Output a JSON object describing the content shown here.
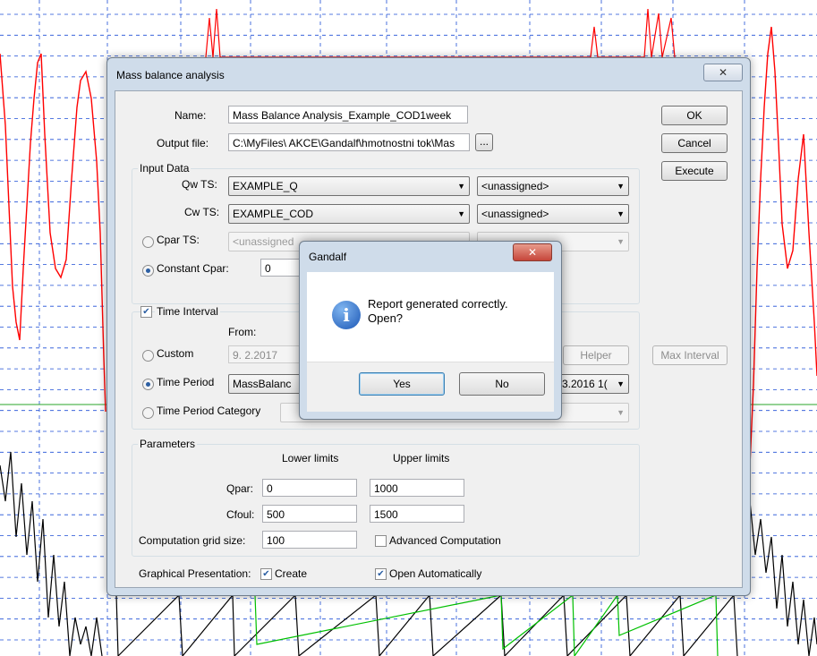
{
  "main_dialog": {
    "title": "Mass balance analysis",
    "close_glyph": "✕",
    "name_label": "Name:",
    "name_value": "Mass Balance Analysis_Example_COD1week",
    "output_label": "Output file:",
    "output_value": "C:\\MyFiles\\ AKCE\\Gandalf\\hmotnostni tok\\Mas",
    "browse_label": "...",
    "buttons": {
      "ok": "OK",
      "cancel": "Cancel",
      "execute": "Execute"
    },
    "input_data": {
      "group_title": "Input Data",
      "qw_label": "Qw TS:",
      "qw_value": "EXAMPLE_Q",
      "qw_secondary": "<unassigned>",
      "cw_label": "Cw TS:",
      "cw_value": "EXAMPLE_COD",
      "cw_secondary": "<unassigned>",
      "cpar_label": "Cpar TS:",
      "cpar_value": "<unassigned",
      "constant_label": "Constant Cpar:",
      "constant_value": "0"
    },
    "time_interval": {
      "checkbox_label": "Time Interval",
      "from_label": "From:",
      "custom_label": "Custom",
      "custom_from": "9.  2.2017",
      "helper_label": "Helper",
      "max_interval_label": "Max Interval",
      "period_label": "Time Period",
      "period_value": "MassBalanc",
      "period_end": "3.2016 1(",
      "category_label": "Time Period Category"
    },
    "parameters": {
      "group_title": "Parameters",
      "lower_header": "Lower limits",
      "upper_header": "Upper limits",
      "qpar_label": "Qpar:",
      "qpar_lower": "0",
      "qpar_upper": "1000",
      "cfoul_label": "Cfoul:",
      "cfoul_lower": "500",
      "cfoul_upper": "1500",
      "grid_label": "Computation grid size:",
      "grid_value": "100",
      "advanced_label": "Advanced Computation"
    },
    "graphical": {
      "label": "Graphical Presentation:",
      "create_label": "Create",
      "open_label": "Open Automatically"
    }
  },
  "message_box": {
    "title": "Gandalf",
    "close_glyph": "✕",
    "icon": "info-icon",
    "message_line1": "Report generated correctly.",
    "message_line2": "Open?",
    "yes_label": "Yes",
    "no_label": "No"
  },
  "colors": {
    "series_red": "#ff0000",
    "series_black": "#000000",
    "series_green": "#00c000",
    "grid_blue": "#1e4fd6"
  }
}
